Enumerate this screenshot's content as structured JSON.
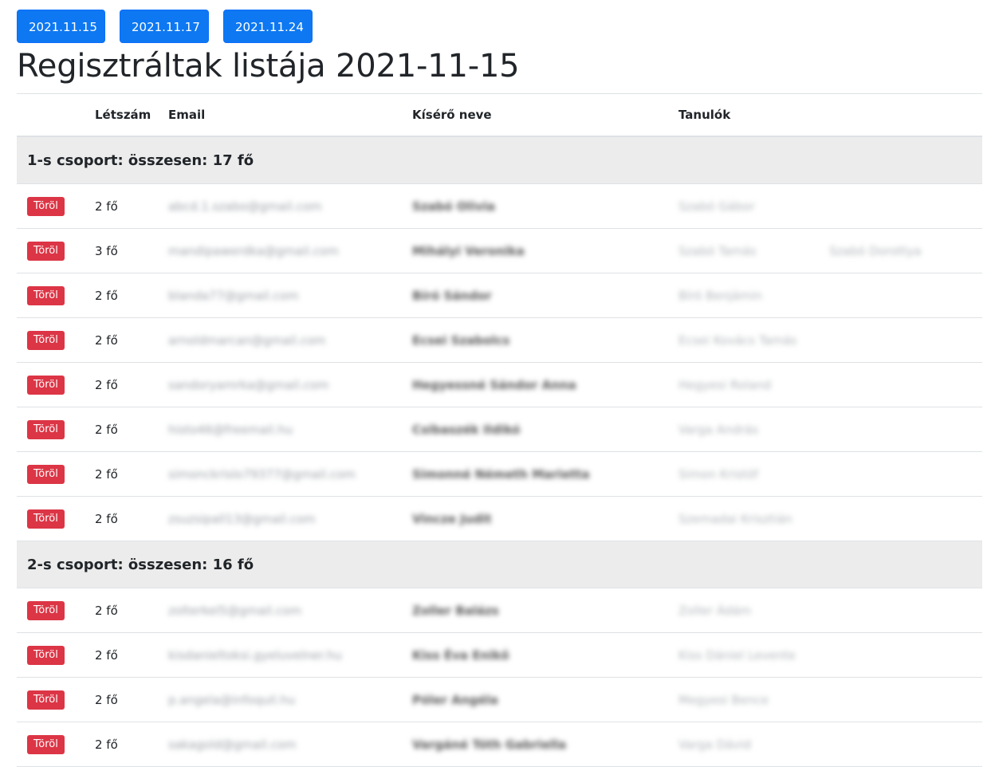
{
  "dates": [
    "2021.11.15",
    "2021.11.17",
    "2021.11.24"
  ],
  "page_title": "Regisztráltak listája 2021-11-15",
  "table": {
    "headers": {
      "count": "Létszám",
      "email": "Email",
      "guide": "Kísérő neve",
      "students": "Tanulók"
    },
    "delete_label": "Töröl",
    "groups": [
      {
        "title": "1-s csoport: összesen: 17 fő",
        "rows": [
          {
            "count": "2 fő",
            "email": "abcd.1.szabo@gmail.com",
            "guide": "Szabó Olivia",
            "student1": "Szabó Gábor",
            "student2": ""
          },
          {
            "count": "3 fő",
            "email": "mandipawerdka@gmail.com",
            "guide": "Mihályi Veronika",
            "student1": "Szabó Tamás",
            "student2": "Szabó Dorottya"
          },
          {
            "count": "2 fő",
            "email": "blanda77@gmail.com",
            "guide": "Bíró Sándor",
            "student1": "Bíró Benjámin",
            "student2": ""
          },
          {
            "count": "2 fő",
            "email": "arnoldmarcan@gmail.com",
            "guide": "Ecsei Szabolcs",
            "student1": "Ecsei Kovács Tamás",
            "student2": ""
          },
          {
            "count": "2 fő",
            "email": "sandoryamrka@gmail.com",
            "guide": "Hegyessné Sándor Anna",
            "student1": "Hegyesi Roland",
            "student2": ""
          },
          {
            "count": "2 fő",
            "email": "histo46@freemail.hu",
            "guide": "Csibaszék Ildikó",
            "student1": "Varga András",
            "student2": ""
          },
          {
            "count": "2 fő",
            "email": "simonckrislo79377@gmail.com",
            "guide": "Simonné Németh Marietta",
            "student1": "Simon Kristóf",
            "student2": ""
          },
          {
            "count": "2 fő",
            "email": "zsuzsipall13@gmail.com",
            "guide": "Vincze Judit",
            "student1": "Szemadai Krisztián",
            "student2": ""
          }
        ]
      },
      {
        "title": "2-s csoport: összesen: 16 fő",
        "rows": [
          {
            "count": "2 fő",
            "email": "zolterkel5@gmail.com",
            "guide": "Zoller Balázs",
            "student1": "Zoller Ádám",
            "student2": ""
          },
          {
            "count": "2 fő",
            "email": "kisdanieltoksi.gyeluvelner.hu",
            "guide": "Kiss Éva Enikő",
            "student1": "Kiss Dániel Levente",
            "student2": ""
          },
          {
            "count": "2 fő",
            "email": "p.angela@infoquil.hu",
            "guide": "Póler Angéla",
            "student1": "Megyesi Bence",
            "student2": ""
          },
          {
            "count": "2 fő",
            "email": "sakagold@gmail.com",
            "guide": "Vargáné Tóth Gabriella",
            "student1": "Varga Dávid",
            "student2": ""
          }
        ]
      }
    ]
  },
  "colors": {
    "primary": "#0d78f2",
    "danger": "#dc3545",
    "group_bg": "#ececec"
  }
}
